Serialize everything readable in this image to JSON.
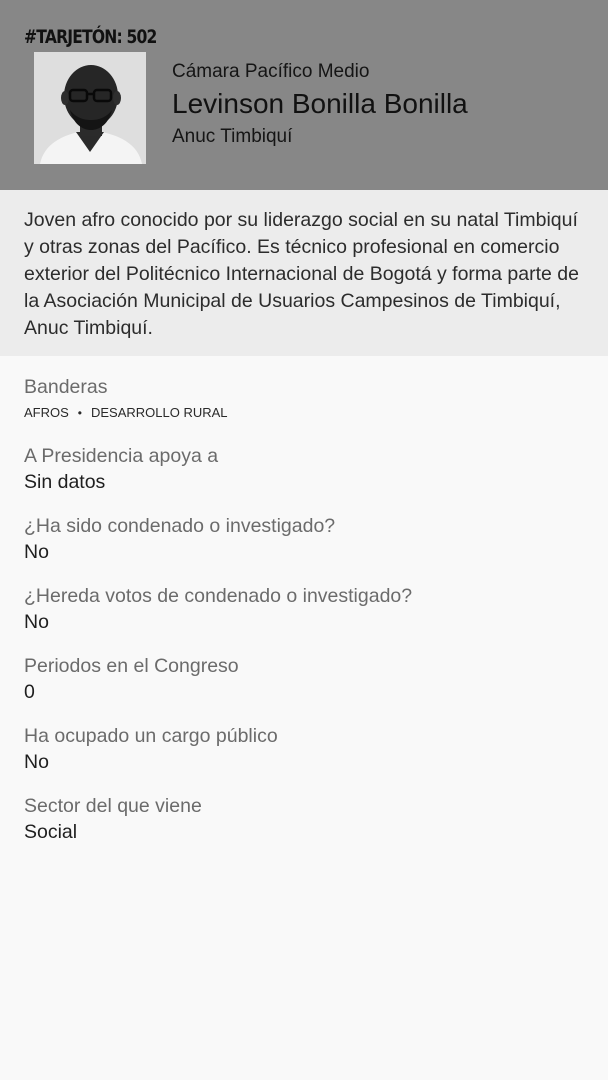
{
  "header": {
    "ballot_code": "#TARJETÓN: 502",
    "chamber": "Cámara Pacífico Medio",
    "candidate_name": "Levinson Bonilla Bonilla",
    "party": "Anuc Timbiquí",
    "background_color": "#878787"
  },
  "bio": {
    "text": "Joven afro conocido por su liderazgo social en su natal Timbiquí y otras zonas del Pacífico. Es técnico profesional en comercio exterior del Politécnico Internacional de Bogotá y forma parte de la Asociación Municipal de Usuarios Campesinos de Timbiquí, Anuc Timbiquí."
  },
  "details": {
    "flags": {
      "label": "Banderas",
      "items": [
        "AFROS",
        "DESARROLLO RURAL"
      ],
      "separator": "•"
    },
    "president_support": {
      "label": "A Presidencia apoya a",
      "value": "Sin datos"
    },
    "convicted": {
      "label": "¿Ha sido condenado o investigado?",
      "value": "No"
    },
    "inherits_votes": {
      "label": "¿Hereda votos de condenado o investigado?",
      "value": "No"
    },
    "congress_periods": {
      "label": "Periodos en el Congreso",
      "value": "0"
    },
    "public_office": {
      "label": "Ha ocupado un cargo público",
      "value": "No"
    },
    "sector": {
      "label": "Sector del que viene",
      "value": "Social"
    }
  }
}
